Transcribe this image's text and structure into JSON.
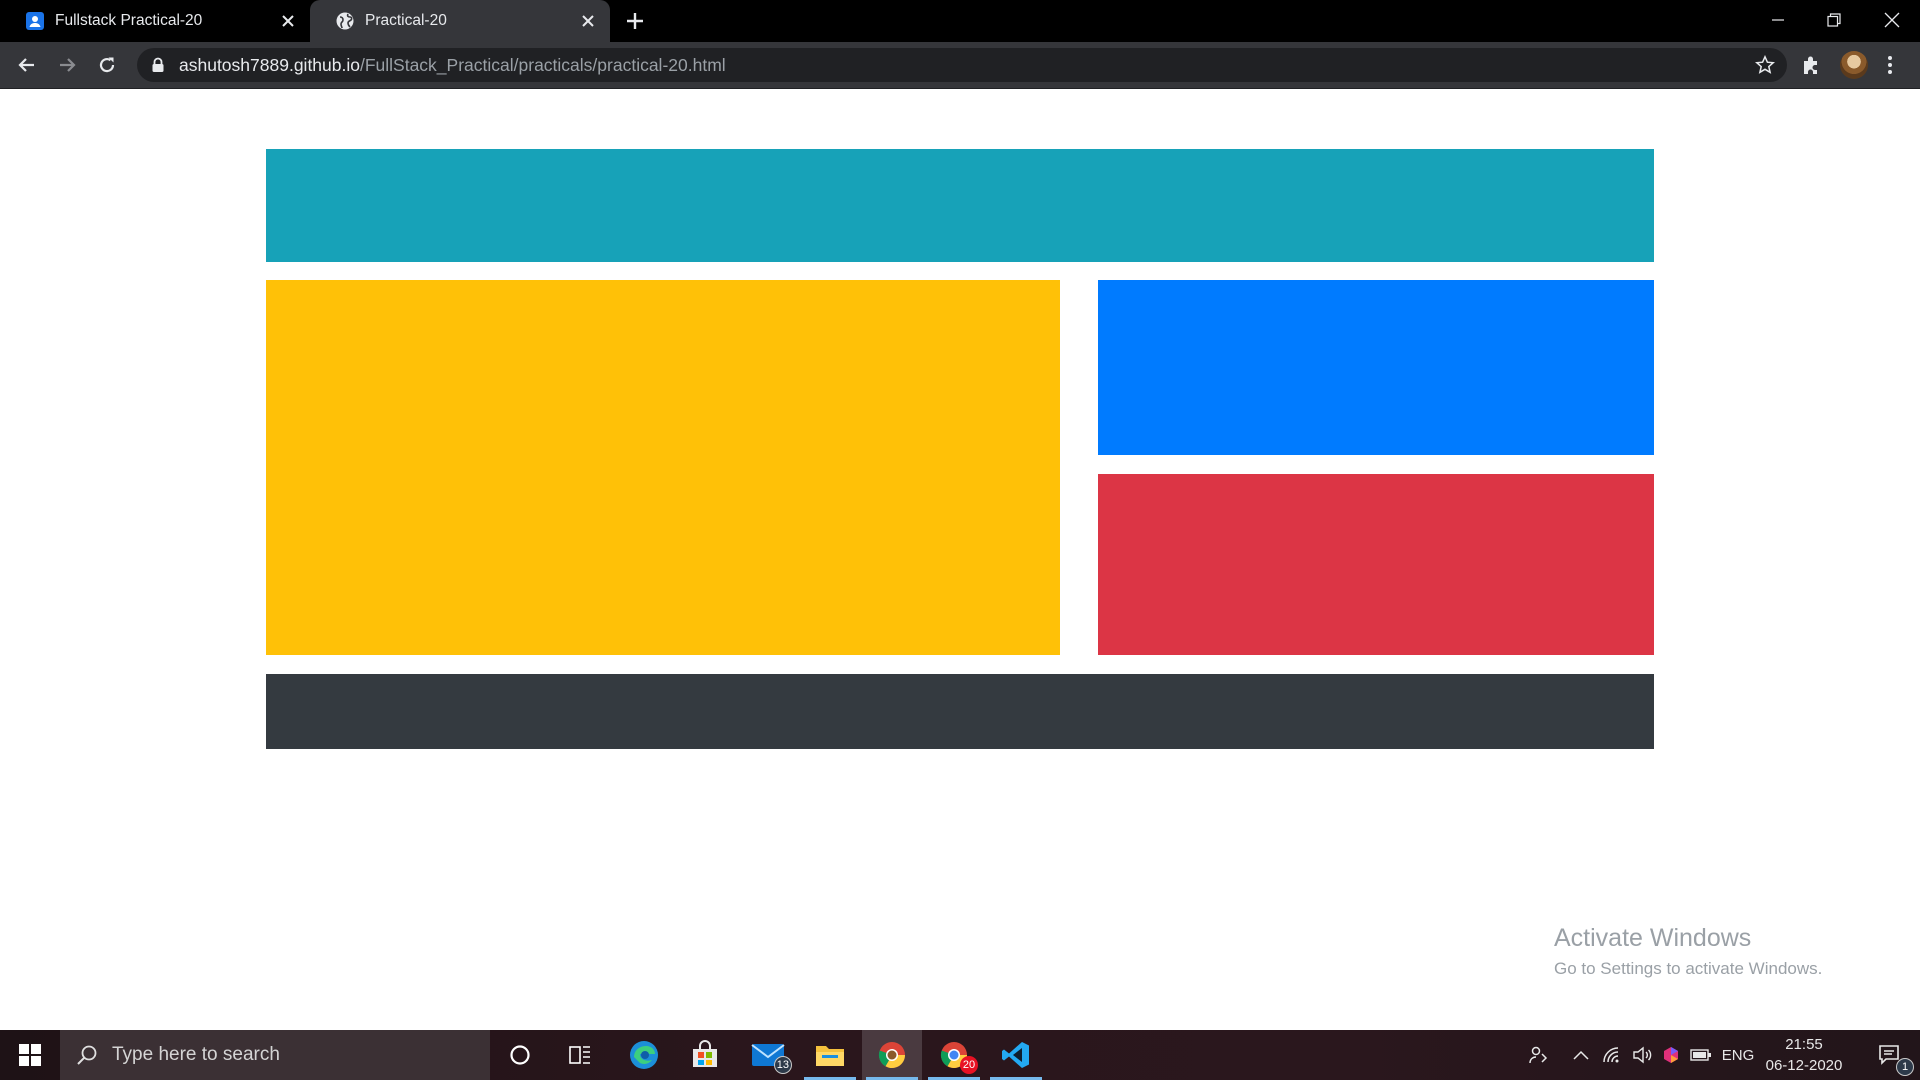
{
  "browser": {
    "tabs": [
      {
        "title": "Fullstack Practical-20",
        "active": false
      },
      {
        "title": "Practical-20",
        "active": true
      }
    ],
    "url_host": "ashutosh7889.github.io",
    "url_path": "/FullStack_Practical/practicals/practical-20.html"
  },
  "page": {
    "colors": {
      "header": "#17a2b8",
      "main": "#ffc107",
      "side_top": "#007bff",
      "side_bottom": "#dc3545",
      "footer": "#343a40"
    }
  },
  "watermark": {
    "line1": "Activate Windows",
    "line2": "Go to Settings to activate Windows."
  },
  "taskbar": {
    "search_placeholder": "Type here to search",
    "apps": [
      {
        "icon": "cortana-icon"
      },
      {
        "icon": "task-view-icon"
      },
      {
        "icon": "edge-icon"
      },
      {
        "icon": "store-icon"
      },
      {
        "icon": "mail-icon",
        "badge": "13"
      },
      {
        "icon": "file-explorer-icon"
      },
      {
        "icon": "chrome-icon"
      },
      {
        "icon": "chrome-profile-icon",
        "badge": "20"
      },
      {
        "icon": "vscode-icon"
      }
    ],
    "language": "ENG",
    "time": "21:55",
    "date": "06-12-2020",
    "notification_count": "1"
  }
}
